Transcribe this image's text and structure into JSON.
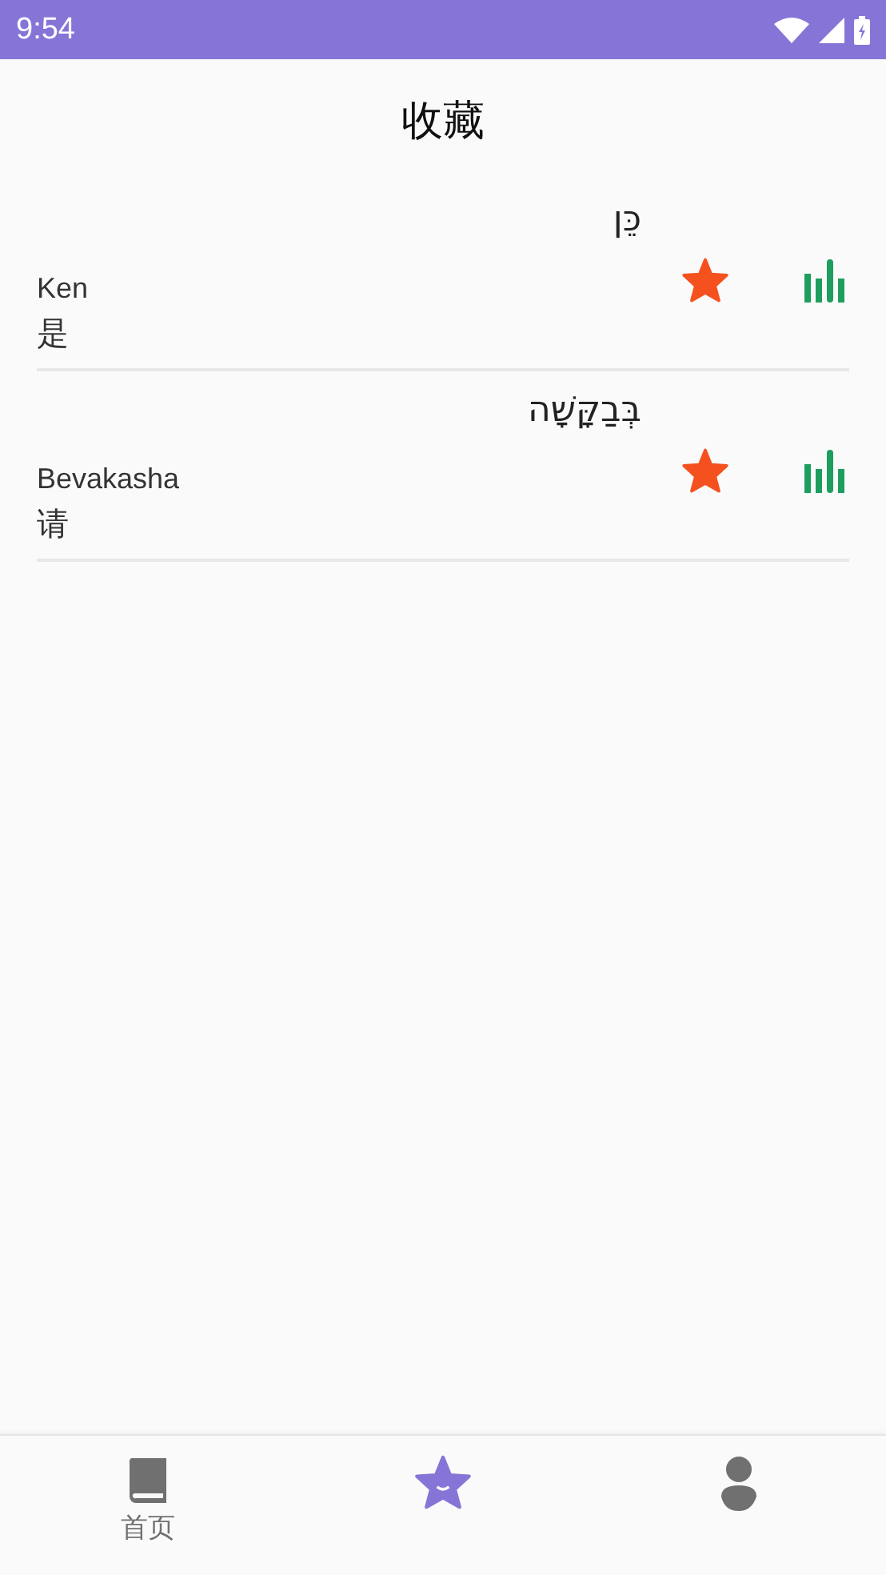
{
  "status_bar": {
    "time": "9:54"
  },
  "header": {
    "title": "收藏"
  },
  "words": [
    {
      "hebrew": "כֵּן",
      "transliteration": "Ken",
      "translation": "是",
      "favorited": true
    },
    {
      "hebrew": "בְּבַקָּשָׁה",
      "transliteration": "Bevakasha",
      "translation": "请",
      "favorited": true
    }
  ],
  "tabs": [
    {
      "kind": "book",
      "label": "首页",
      "selected": false
    },
    {
      "kind": "star",
      "selected": true
    },
    {
      "kind": "person",
      "selected": false
    }
  ]
}
